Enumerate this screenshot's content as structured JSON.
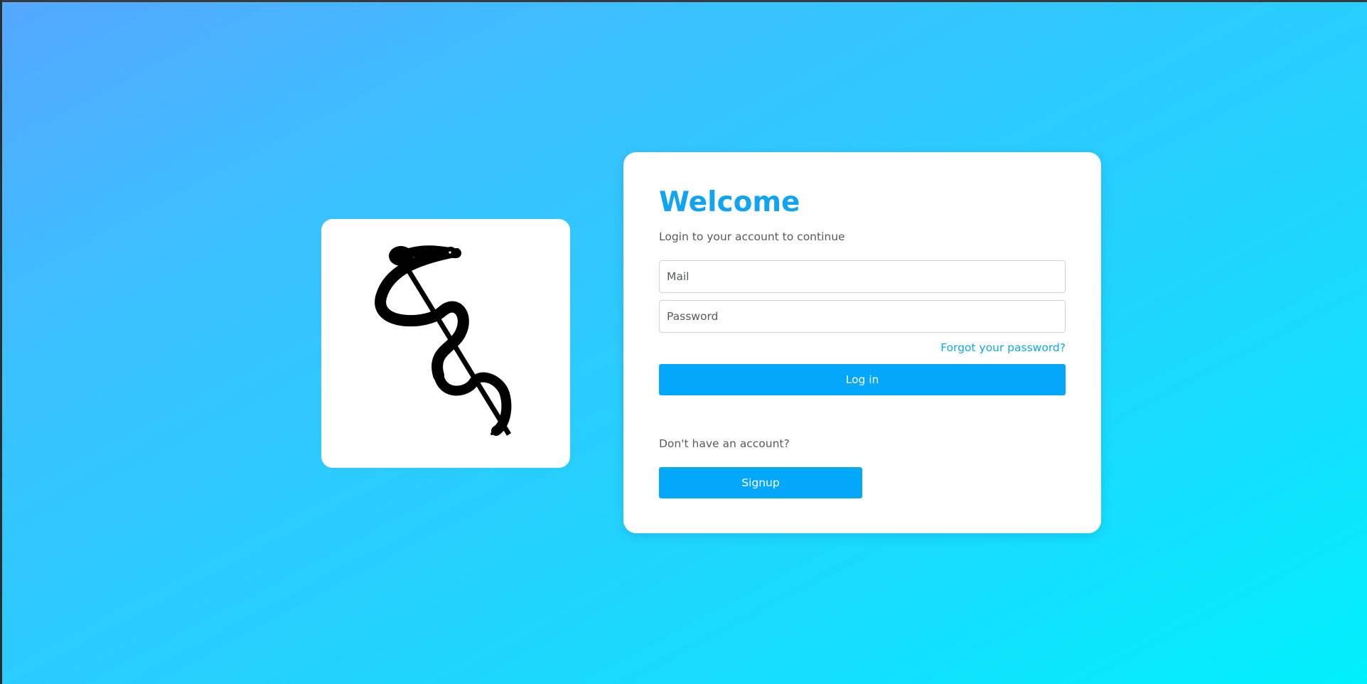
{
  "login": {
    "title": "Welcome",
    "subtitle": "Login to your account to continue",
    "mail_placeholder": "Mail",
    "password_placeholder": "Password",
    "forgot_password": "Forgot your password?",
    "login_button": "Log in",
    "no_account_text": "Don't have an account?",
    "signup_button": "Signup"
  },
  "logo": {
    "icon": "rod-of-asclepius-icon"
  },
  "colors": {
    "accent": "#03a8fb",
    "title": "#10a4f2",
    "link": "#10a9e8",
    "background_start": "#55a7ff",
    "background_end": "#00f0fd"
  }
}
